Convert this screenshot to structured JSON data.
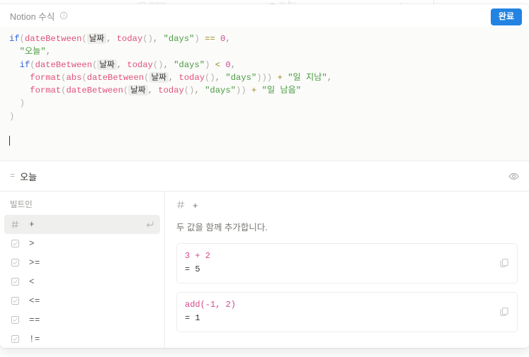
{
  "backdrop": {
    "items": [
      {
        "icon": "gallery-icon",
        "label": "갤러리"
      },
      {
        "icon": "eye-icon",
        "label": "가나다"
      },
      {
        "icon": "plus-icon",
        "label": "+"
      },
      {
        "icon": "more-icon",
        "label": "…"
      }
    ]
  },
  "header": {
    "title": "Notion 수식",
    "help_icon": "question-circle-icon",
    "done_label": "완료"
  },
  "editor": {
    "property_chip": "날짜",
    "lines": [
      {
        "indent": 0,
        "tokens": [
          {
            "t": "kw",
            "v": "if"
          },
          {
            "t": "punct",
            "v": "("
          },
          {
            "t": "fn",
            "v": "dateBetween"
          },
          {
            "t": "punct",
            "v": "("
          },
          {
            "t": "prop",
            "v": "날짜"
          },
          {
            "t": "comma",
            "v": ", "
          },
          {
            "t": "fn",
            "v": "today"
          },
          {
            "t": "punct",
            "v": "()"
          },
          {
            "t": "comma",
            "v": ", "
          },
          {
            "t": "str",
            "v": "\"days\""
          },
          {
            "t": "punct",
            "v": ")"
          },
          {
            "t": "plain",
            "v": " "
          },
          {
            "t": "op",
            "v": "=="
          },
          {
            "t": "plain",
            "v": " "
          },
          {
            "t": "num",
            "v": "0"
          },
          {
            "t": "comma",
            "v": ","
          }
        ]
      },
      {
        "indent": 1,
        "tokens": [
          {
            "t": "str",
            "v": "\"오늘\""
          },
          {
            "t": "comma",
            "v": ","
          }
        ]
      },
      {
        "indent": 1,
        "tokens": [
          {
            "t": "kw",
            "v": "if"
          },
          {
            "t": "punct",
            "v": "("
          },
          {
            "t": "fn",
            "v": "dateBetween"
          },
          {
            "t": "punct",
            "v": "("
          },
          {
            "t": "prop",
            "v": "날짜"
          },
          {
            "t": "comma",
            "v": ", "
          },
          {
            "t": "fn",
            "v": "today"
          },
          {
            "t": "punct",
            "v": "()"
          },
          {
            "t": "comma",
            "v": ", "
          },
          {
            "t": "str",
            "v": "\"days\""
          },
          {
            "t": "punct",
            "v": ")"
          },
          {
            "t": "plain",
            "v": " "
          },
          {
            "t": "op",
            "v": "<"
          },
          {
            "t": "plain",
            "v": " "
          },
          {
            "t": "num",
            "v": "0"
          },
          {
            "t": "comma",
            "v": ","
          }
        ]
      },
      {
        "indent": 2,
        "tokens": [
          {
            "t": "fn",
            "v": "format"
          },
          {
            "t": "punct",
            "v": "("
          },
          {
            "t": "fn",
            "v": "abs"
          },
          {
            "t": "punct",
            "v": "("
          },
          {
            "t": "fn",
            "v": "dateBetween"
          },
          {
            "t": "punct",
            "v": "("
          },
          {
            "t": "prop",
            "v": "날짜"
          },
          {
            "t": "comma",
            "v": ", "
          },
          {
            "t": "fn",
            "v": "today"
          },
          {
            "t": "punct",
            "v": "()"
          },
          {
            "t": "comma",
            "v": ", "
          },
          {
            "t": "str",
            "v": "\"days\""
          },
          {
            "t": "punct",
            "v": ")))"
          },
          {
            "t": "plain",
            "v": " "
          },
          {
            "t": "op",
            "v": "+"
          },
          {
            "t": "plain",
            "v": " "
          },
          {
            "t": "str",
            "v": "\"일 지남\""
          },
          {
            "t": "comma",
            "v": ","
          }
        ]
      },
      {
        "indent": 2,
        "tokens": [
          {
            "t": "fn",
            "v": "format"
          },
          {
            "t": "punct",
            "v": "("
          },
          {
            "t": "fn",
            "v": "dateBetween"
          },
          {
            "t": "punct",
            "v": "("
          },
          {
            "t": "prop",
            "v": "날짜"
          },
          {
            "t": "comma",
            "v": ", "
          },
          {
            "t": "fn",
            "v": "today"
          },
          {
            "t": "punct",
            "v": "()"
          },
          {
            "t": "comma",
            "v": ", "
          },
          {
            "t": "str",
            "v": "\"days\""
          },
          {
            "t": "punct",
            "v": "))"
          },
          {
            "t": "plain",
            "v": " "
          },
          {
            "t": "op",
            "v": "+"
          },
          {
            "t": "plain",
            "v": " "
          },
          {
            "t": "str",
            "v": "\"일 남음\""
          }
        ]
      },
      {
        "indent": 1,
        "tokens": [
          {
            "t": "punct",
            "v": ")"
          }
        ]
      },
      {
        "indent": 0,
        "tokens": [
          {
            "t": "punct",
            "v": ")"
          }
        ]
      },
      {
        "indent": 0,
        "tokens": []
      },
      {
        "indent": 0,
        "tokens": [],
        "caret": true
      }
    ]
  },
  "result": {
    "equals_sign": "=",
    "value": "오늘",
    "visibility_icon": "eye-icon"
  },
  "function_list": {
    "heading": "빌트인",
    "enter_icon": "enter-return-icon",
    "items": [
      {
        "icon": "number-hash-icon",
        "label": "+",
        "selected": true
      },
      {
        "icon": "checkbox-icon",
        "label": ">",
        "selected": false
      },
      {
        "icon": "checkbox-icon",
        "label": ">=",
        "selected": false
      },
      {
        "icon": "checkbox-icon",
        "label": "<",
        "selected": false
      },
      {
        "icon": "checkbox-icon",
        "label": "<=",
        "selected": false
      },
      {
        "icon": "checkbox-icon",
        "label": "==",
        "selected": false
      },
      {
        "icon": "checkbox-icon",
        "label": "!=",
        "selected": false
      }
    ]
  },
  "detail": {
    "icon": "number-hash-icon",
    "name": "+",
    "description": "두 값을 함께 추가합니다.",
    "copy_icon": "copy-icon",
    "examples": [
      {
        "code": "3 + 2",
        "result": "= 5"
      },
      {
        "code": "add(-1, 2)",
        "result": "= 1"
      }
    ]
  },
  "colors": {
    "accent_blue": "#2383e2",
    "keyword": "#2c63d6",
    "function": "#e0527a",
    "string": "#4a9b3f",
    "number": "#d0488c",
    "operator": "#9a8b20",
    "editor_bg": "#fbfbfa",
    "selected_row": "#efefee"
  }
}
